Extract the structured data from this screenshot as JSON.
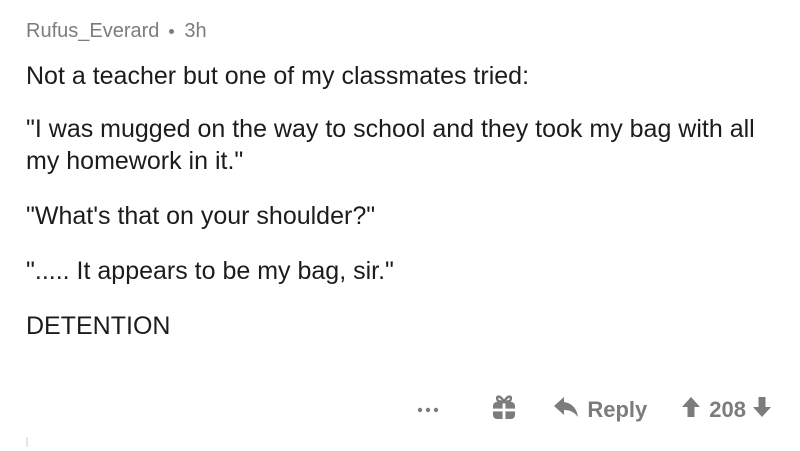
{
  "comment": {
    "author": "Rufus_Everard",
    "age": "3h",
    "paragraphs": [
      "Not a teacher but one of my classmates tried:",
      "\"I was mugged on the way to school and they took my bag with all my homework in it.\"",
      "\"What's that on your shoulder?\"",
      "\"..... It appears to be my bag, sir.\"",
      "DETENTION"
    ]
  },
  "actions": {
    "more_icon": "ellipsis-icon",
    "award_icon": "gift-icon",
    "reply_icon": "reply-arrow-icon",
    "reply_label": "Reply",
    "upvote_icon": "upvote-arrow-icon",
    "score": "208",
    "downvote_icon": "downvote-arrow-icon"
  },
  "colors": {
    "text": "#1c1c1c",
    "muted": "#7c7c7c",
    "background": "#ffffff"
  }
}
